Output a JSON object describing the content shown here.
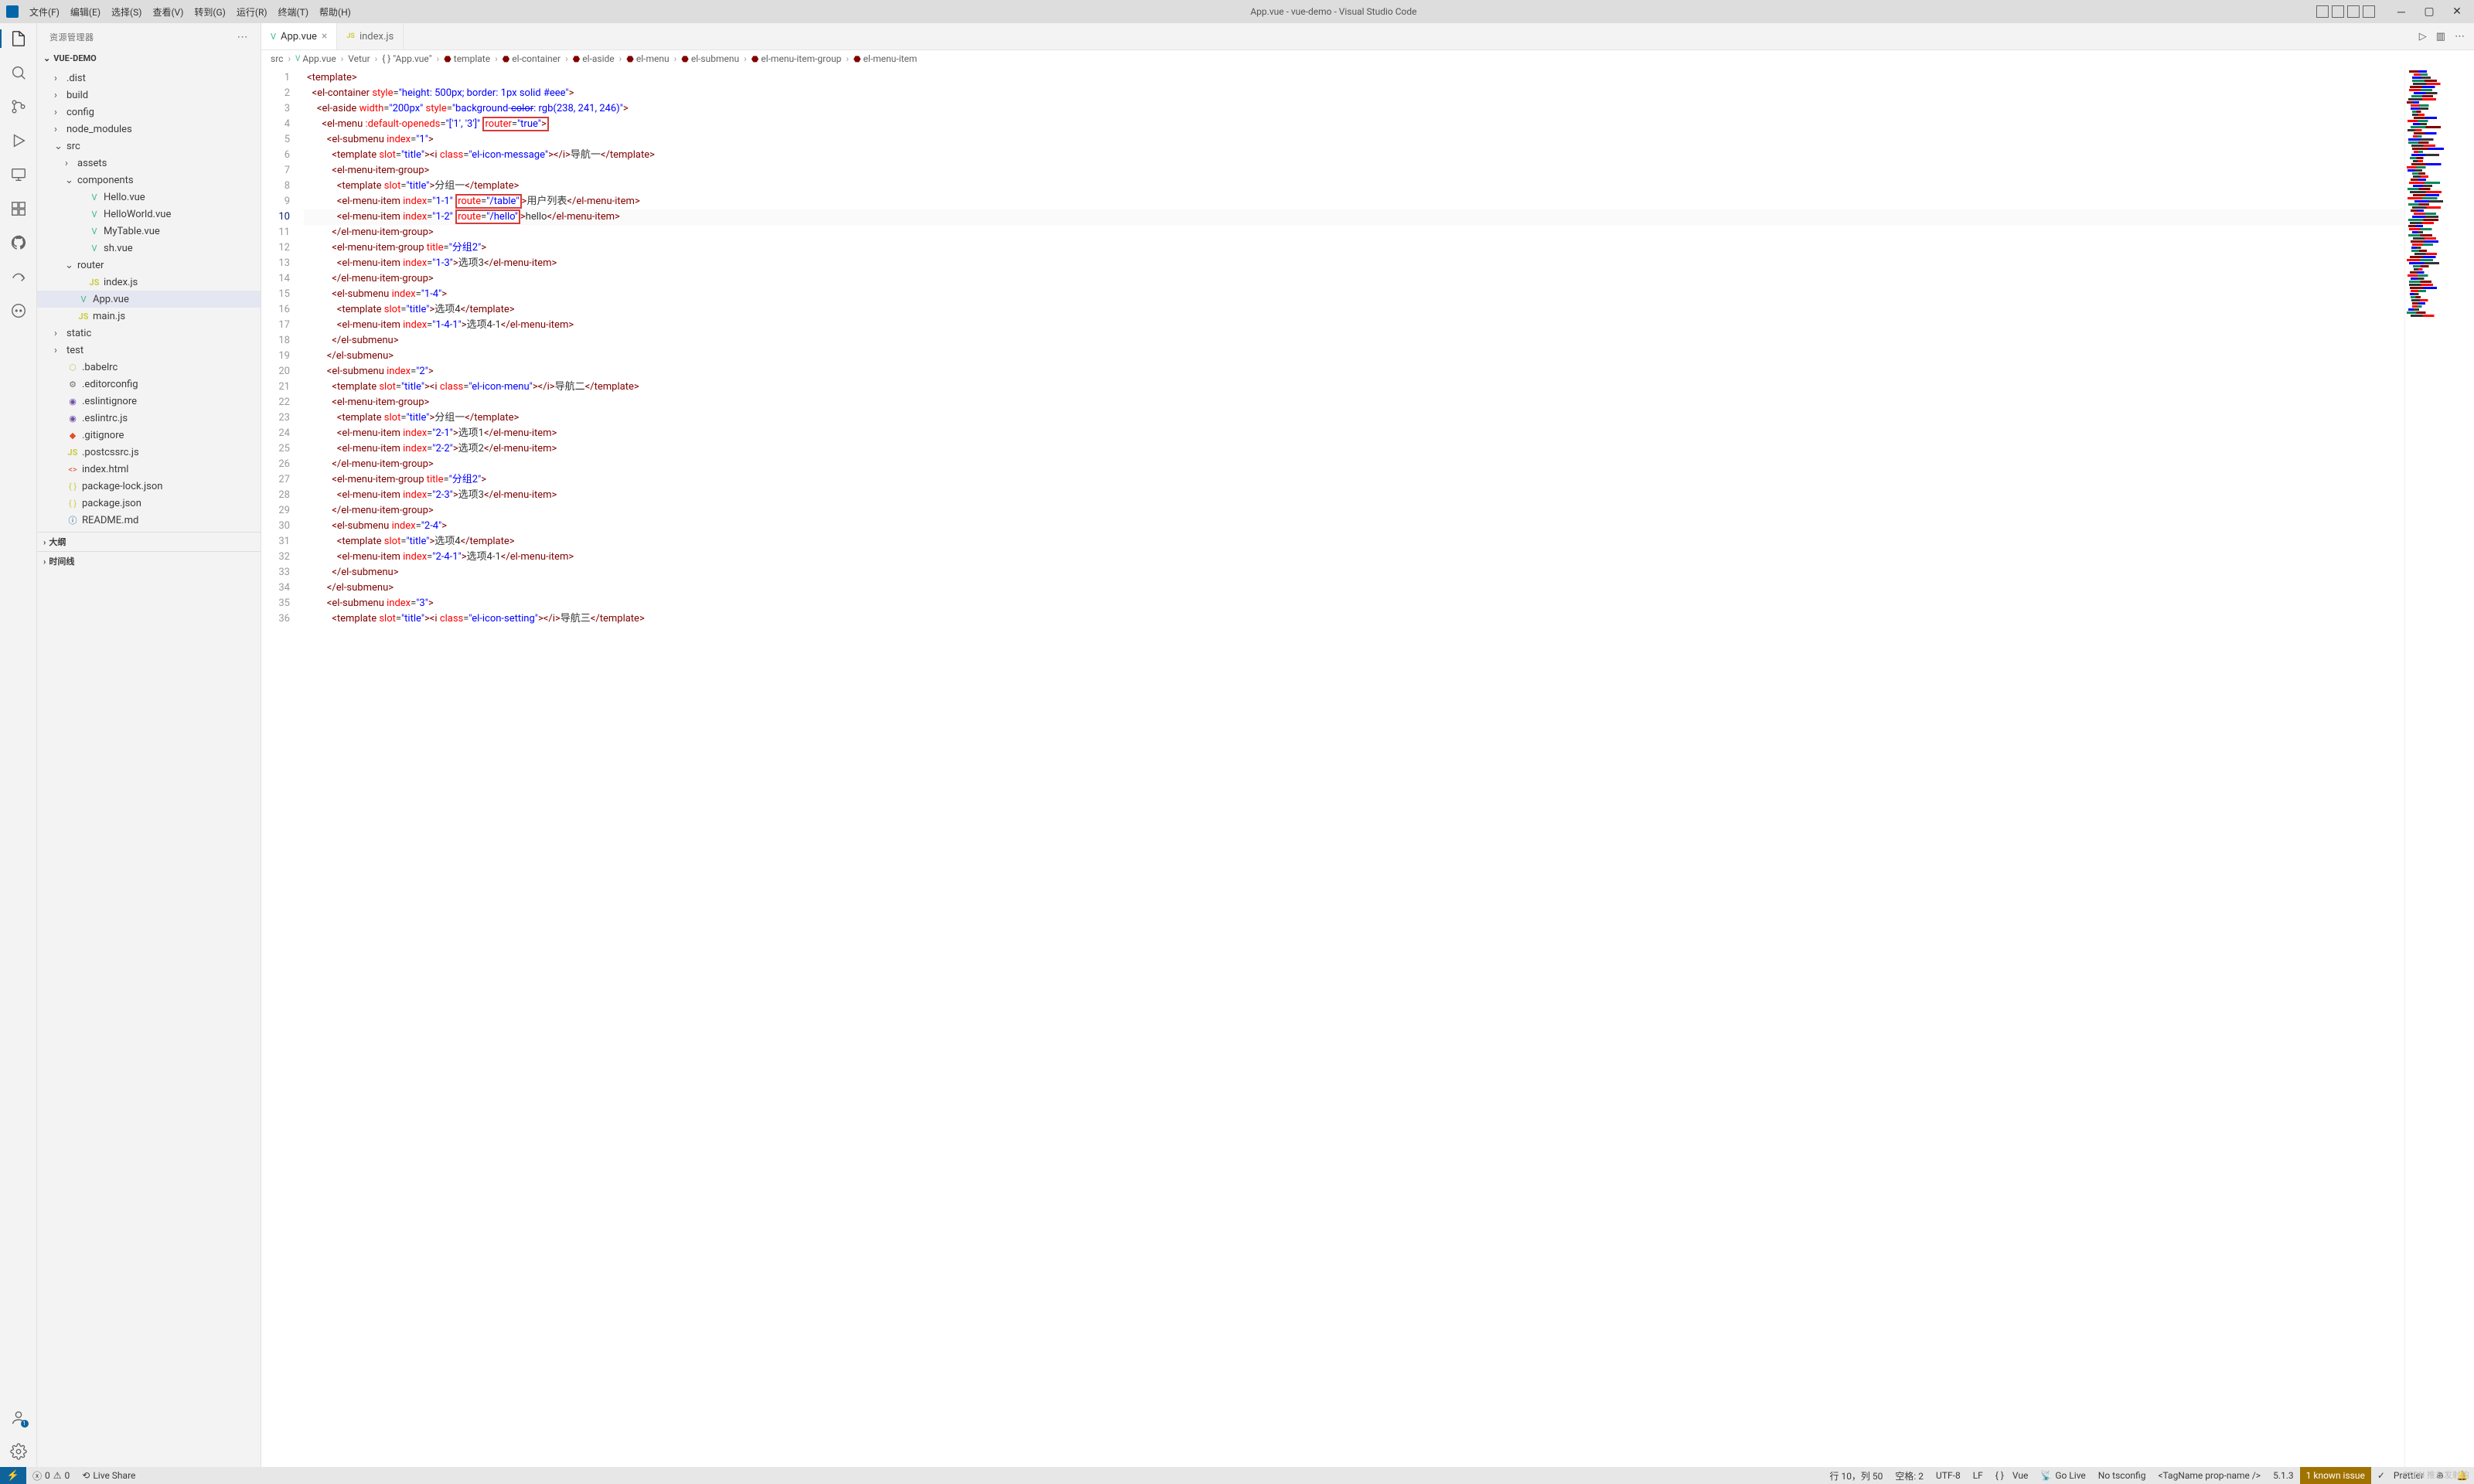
{
  "title": "App.vue - vue-demo - Visual Studio Code",
  "menus": [
    "文件(F)",
    "编辑(E)",
    "选择(S)",
    "查看(V)",
    "转到(G)",
    "运行(R)",
    "终端(T)",
    "帮助(H)"
  ],
  "sidebar": {
    "title": "资源管理器",
    "project": "VUE-DEMO",
    "tree": [
      {
        "label": ".dist",
        "type": "folder",
        "expanded": false,
        "depth": 1
      },
      {
        "label": "build",
        "type": "folder",
        "expanded": false,
        "depth": 1
      },
      {
        "label": "config",
        "type": "folder",
        "expanded": false,
        "depth": 1
      },
      {
        "label": "node_modules",
        "type": "folder",
        "expanded": false,
        "depth": 1
      },
      {
        "label": "src",
        "type": "folder",
        "expanded": true,
        "depth": 1
      },
      {
        "label": "assets",
        "type": "folder",
        "expanded": false,
        "depth": 2
      },
      {
        "label": "components",
        "type": "folder",
        "expanded": true,
        "depth": 2
      },
      {
        "label": "Hello.vue",
        "type": "vue",
        "depth": 3
      },
      {
        "label": "HelloWorld.vue",
        "type": "vue",
        "depth": 3
      },
      {
        "label": "MyTable.vue",
        "type": "vue",
        "depth": 3
      },
      {
        "label": "sh.vue",
        "type": "vue",
        "depth": 3
      },
      {
        "label": "router",
        "type": "folder",
        "expanded": true,
        "depth": 2
      },
      {
        "label": "index.js",
        "type": "js",
        "depth": 3
      },
      {
        "label": "App.vue",
        "type": "vue",
        "depth": 2,
        "selected": true
      },
      {
        "label": "main.js",
        "type": "js",
        "depth": 2
      },
      {
        "label": "static",
        "type": "folder",
        "expanded": false,
        "depth": 1
      },
      {
        "label": "test",
        "type": "folder",
        "expanded": false,
        "depth": 1
      },
      {
        "label": ".babelrc",
        "type": "babel",
        "depth": 1
      },
      {
        "label": ".editorconfig",
        "type": "gear",
        "depth": 1
      },
      {
        "label": ".eslintignore",
        "type": "eslint",
        "depth": 1
      },
      {
        "label": ".eslintrc.js",
        "type": "eslint",
        "depth": 1
      },
      {
        "label": ".gitignore",
        "type": "git",
        "depth": 1
      },
      {
        "label": ".postcssrc.js",
        "type": "js",
        "depth": 1
      },
      {
        "label": "index.html",
        "type": "html",
        "depth": 1
      },
      {
        "label": "package-lock.json",
        "type": "json",
        "depth": 1
      },
      {
        "label": "package.json",
        "type": "json",
        "depth": 1
      },
      {
        "label": "README.md",
        "type": "info",
        "depth": 1
      }
    ],
    "sections": [
      "大纲",
      "时间线"
    ]
  },
  "tabs": [
    {
      "label": "App.vue",
      "icon": "vue",
      "active": true
    },
    {
      "label": "index.js",
      "icon": "js",
      "active": false
    }
  ],
  "breadcrumb": [
    {
      "label": "src",
      "icon": ""
    },
    {
      "label": "App.vue",
      "icon": "vue"
    },
    {
      "label": "Vetur",
      "icon": ""
    },
    {
      "label": "\"App.vue\"",
      "icon": "curly"
    },
    {
      "label": "template",
      "icon": "el"
    },
    {
      "label": "el-container",
      "icon": "el"
    },
    {
      "label": "el-aside",
      "icon": "el"
    },
    {
      "label": "el-menu",
      "icon": "el"
    },
    {
      "label": "el-submenu",
      "icon": "el"
    },
    {
      "label": "el-menu-item-group",
      "icon": "el"
    },
    {
      "label": "el-menu-item",
      "icon": "el"
    }
  ],
  "code": {
    "content_text": "<template>\n  <el-container style=\"height: 500px; border: 1px solid #eee\">\n    <el-aside width=\"200px\" style=\"background-color: rgb(238, 241, 246)\">\n      <el-menu :default-openeds=\"['1', '3']\" router=\"true\">\n        <el-submenu index=\"1\">\n          <template slot=\"title\"><i class=\"el-icon-message\"></i>导航一</template>\n          <el-menu-item-group>\n            <template slot=\"title\">分组一</template>\n            <el-menu-item index=\"1-1\" route=\"/table\">用户列表</el-menu-item>\n            <el-menu-item index=\"1-2\" route=\"/hello\">hello</el-menu-item>\n          </el-menu-item-group>\n          <el-menu-item-group title=\"分组2\">\n            <el-menu-item index=\"1-3\">选项3</el-menu-item>\n          </el-menu-item-group>\n          <el-submenu index=\"1-4\">\n            <template slot=\"title\">选项4</template>\n            <el-menu-item index=\"1-4-1\">选项4-1</el-menu-item>\n          </el-submenu>\n        </el-submenu>\n        <el-submenu index=\"2\">\n          <template slot=\"title\"><i class=\"el-icon-menu\"></i>导航二</template>\n          <el-menu-item-group>\n            <template slot=\"title\">分组一</template>\n            <el-menu-item index=\"2-1\">选项1</el-menu-item>\n            <el-menu-item index=\"2-2\">选项2</el-menu-item>\n          </el-menu-item-group>\n          <el-menu-item-group title=\"分组2\">\n            <el-menu-item index=\"2-3\">选项3</el-menu-item>\n          </el-menu-item-group>\n          <el-submenu index=\"2-4\">\n            <template slot=\"title\">选项4</template>\n            <el-menu-item index=\"2-4-1\">选项4-1</el-menu-item>\n          </el-submenu>\n        </el-submenu>\n        <el-submenu index=\"3\">\n          <template slot=\"title\"><i class=\"el-icon-setting\"></i>导航三</template>",
    "current_line": 10,
    "total_lines": 36
  },
  "statusbar": {
    "errors": "0",
    "warnings": "0",
    "live_share": "Live Share",
    "cursor": "行 10，列 50",
    "spaces": "空格: 2",
    "encoding": "UTF-8",
    "eol": "LF",
    "lang_icon": "{ }",
    "lang": "Vue",
    "golive": "Go Live",
    "tsconfig": "No tsconfig",
    "tagname": "<TagName prop-name />",
    "version": "5.1.3",
    "issues": "1 known issue",
    "prettier": "Prettier"
  },
  "watermark": "CSDN 推左发射钩"
}
